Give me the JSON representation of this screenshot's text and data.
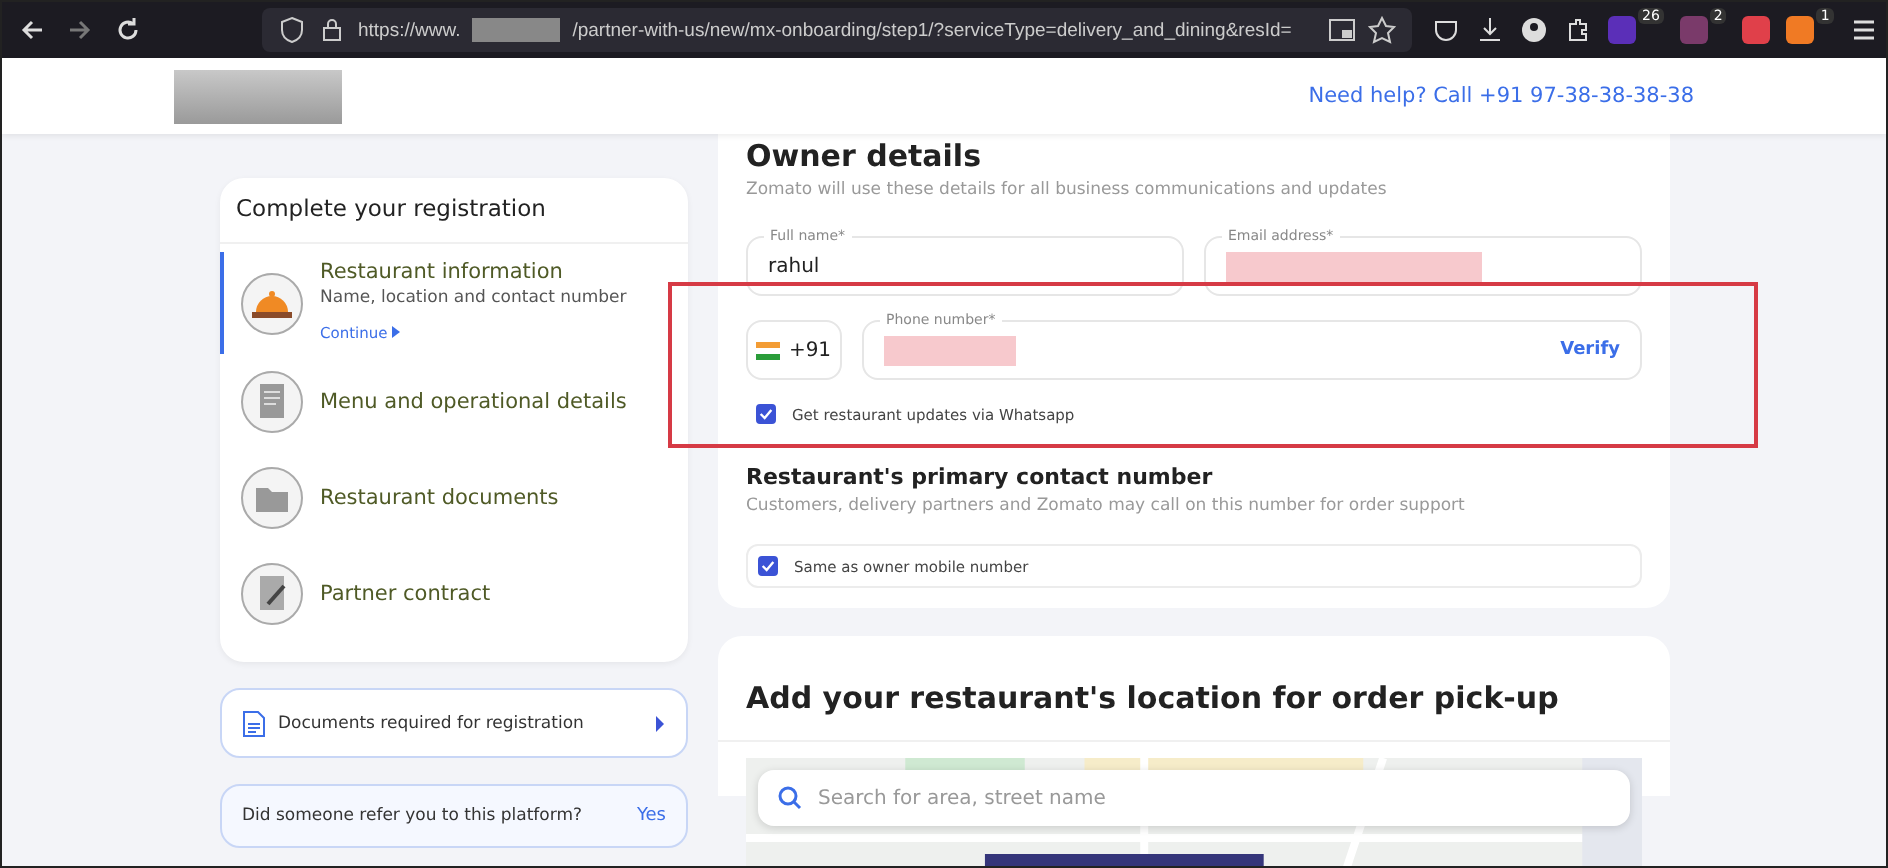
{
  "browser": {
    "url_start": "https://www.",
    "url_rest": "/partner-with-us/new/mx-onboarding/step1/?serviceType=delivery_and_dining&resId=",
    "badges": [
      {
        "kind": "purple",
        "count": "26"
      },
      {
        "kind": "dots",
        "count": "2"
      },
      {
        "kind": "red"
      },
      {
        "kind": "orange",
        "count": "1"
      }
    ]
  },
  "header": {
    "help": "Need help? Call +91 97-38-38-38-38"
  },
  "registration": {
    "title": "Complete your registration",
    "steps": [
      {
        "name": "Restaurant information",
        "subtitle": "Name, location and contact number",
        "link": "Continue",
        "selected": true,
        "kind": "bell"
      },
      {
        "name": "Menu and operational details",
        "selected": false,
        "kind": "menu"
      },
      {
        "name": "Restaurant documents",
        "selected": false,
        "kind": "folder"
      },
      {
        "name": "Partner contract",
        "selected": false,
        "kind": "contract"
      }
    ]
  },
  "documents_link": "Documents required for registration",
  "referral": {
    "question": "Did someone refer you to this platform?",
    "action": "Yes"
  },
  "owner": {
    "title": "Owner details",
    "subtitle": "Zomato will use these details for all business communications and updates",
    "full_name": {
      "label": "Full name*",
      "value": "rahul"
    },
    "email": {
      "label": "Email address*"
    },
    "phone": {
      "code": "+91",
      "label": "Phone number*",
      "action": "Verify"
    },
    "whatsapp": {
      "label": "Get restaurant updates via Whatsapp",
      "checked": true
    }
  },
  "primary_contact": {
    "title": "Restaurant's primary contact number",
    "subtitle": "Customers, delivery partners and Zomato may call on this number for order support",
    "same": {
      "label": "Same as owner mobile number",
      "checked": true
    }
  },
  "location": {
    "title": "Add your restaurant's location for order pick-up",
    "search": {
      "placeholder": "Search for area, street name"
    }
  }
}
